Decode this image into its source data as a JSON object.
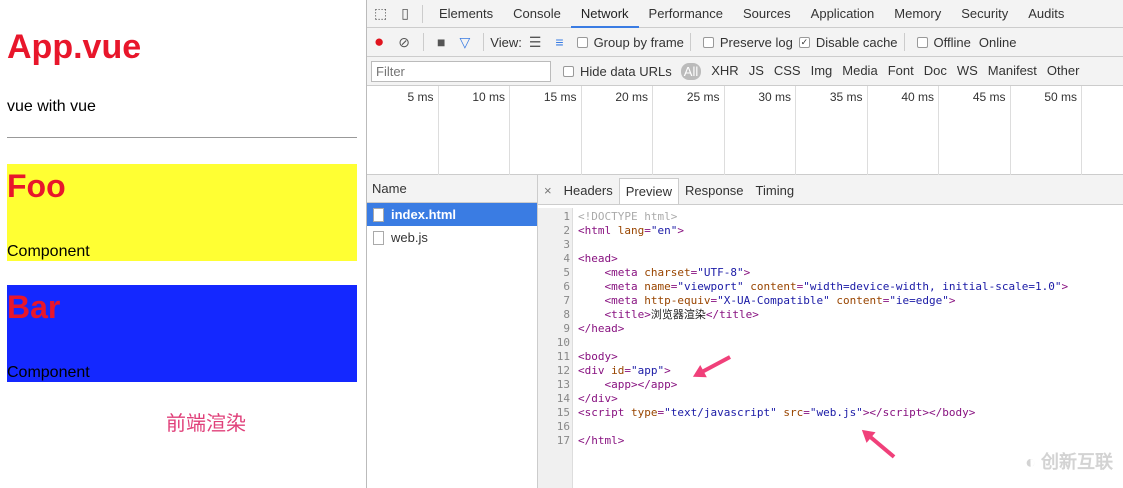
{
  "page": {
    "title": "App.vue",
    "subtitle": "vue with vue",
    "foo": {
      "title": "Foo",
      "label": "Component",
      "bg": "#ffff33"
    },
    "bar": {
      "title": "Bar",
      "label": "Component",
      "bg": "#1428ff"
    },
    "render_label": "前端渲染"
  },
  "devtools": {
    "tabs": [
      "Elements",
      "Console",
      "Network",
      "Performance",
      "Sources",
      "Application",
      "Memory",
      "Security",
      "Audits"
    ],
    "active_tab": "Network",
    "toolbar": {
      "view_label": "View:",
      "group_by_frame": "Group by frame",
      "preserve_log": "Preserve log",
      "disable_cache": "Disable cache",
      "disable_cache_checked": true,
      "offline": "Offline",
      "throttle": "Online"
    },
    "filter": {
      "placeholder": "Filter",
      "hide_data_urls": "Hide data URLs",
      "types": [
        "All",
        "XHR",
        "JS",
        "CSS",
        "Img",
        "Media",
        "Font",
        "Doc",
        "WS",
        "Manifest",
        "Other"
      ],
      "active_type": "All"
    },
    "timeline_ticks": [
      "5 ms",
      "10 ms",
      "15 ms",
      "20 ms",
      "25 ms",
      "30 ms",
      "35 ms",
      "40 ms",
      "45 ms",
      "50 ms"
    ],
    "name_header": "Name",
    "files": [
      {
        "name": "index.html",
        "selected": true
      },
      {
        "name": "web.js",
        "selected": false
      }
    ],
    "detail_tabs": [
      "Headers",
      "Preview",
      "Response",
      "Timing"
    ],
    "active_detail_tab": "Preview",
    "code_lines": [
      [
        [
          "doc",
          "<!DOCTYPE html>"
        ]
      ],
      [
        [
          "tag",
          "<html "
        ],
        [
          "attr",
          "lang"
        ],
        [
          "tag",
          "="
        ],
        [
          "val",
          "\"en\""
        ],
        [
          "tag",
          ">"
        ]
      ],
      [],
      [
        [
          "tag",
          "<head>"
        ]
      ],
      [
        [
          "txt",
          "    "
        ],
        [
          "tag",
          "<meta "
        ],
        [
          "attr",
          "charset"
        ],
        [
          "tag",
          "="
        ],
        [
          "val",
          "\"UTF-8\""
        ],
        [
          "tag",
          ">"
        ]
      ],
      [
        [
          "txt",
          "    "
        ],
        [
          "tag",
          "<meta "
        ],
        [
          "attr",
          "name"
        ],
        [
          "tag",
          "="
        ],
        [
          "val",
          "\"viewport\" "
        ],
        [
          "attr",
          "content"
        ],
        [
          "tag",
          "="
        ],
        [
          "val",
          "\"width=device-width, initial-scale=1.0\""
        ],
        [
          "tag",
          ">"
        ]
      ],
      [
        [
          "txt",
          "    "
        ],
        [
          "tag",
          "<meta "
        ],
        [
          "attr",
          "http-equiv"
        ],
        [
          "tag",
          "="
        ],
        [
          "val",
          "\"X-UA-Compatible\" "
        ],
        [
          "attr",
          "content"
        ],
        [
          "tag",
          "="
        ],
        [
          "val",
          "\"ie=edge\""
        ],
        [
          "tag",
          ">"
        ]
      ],
      [
        [
          "txt",
          "    "
        ],
        [
          "tag",
          "<title>"
        ],
        [
          "txt",
          "浏览器渲染"
        ],
        [
          "tag",
          "</title>"
        ]
      ],
      [
        [
          "tag",
          "</head>"
        ]
      ],
      [],
      [
        [
          "tag",
          "<body>"
        ]
      ],
      [
        [
          "tag",
          "<div "
        ],
        [
          "attr",
          "id"
        ],
        [
          "tag",
          "="
        ],
        [
          "val",
          "\"app\""
        ],
        [
          "tag",
          ">"
        ]
      ],
      [
        [
          "txt",
          "    "
        ],
        [
          "tag",
          "<app></app>"
        ]
      ],
      [
        [
          "tag",
          "</div>"
        ]
      ],
      [
        [
          "tag",
          "<script "
        ],
        [
          "attr",
          "type"
        ],
        [
          "tag",
          "="
        ],
        [
          "val",
          "\"text/javascript\" "
        ],
        [
          "attr",
          "src"
        ],
        [
          "tag",
          "="
        ],
        [
          "val",
          "\"web.js\""
        ],
        [
          "tag",
          "></script></body>"
        ]
      ],
      [],
      [
        [
          "tag",
          "</html>"
        ]
      ]
    ]
  },
  "watermark": "创新互联"
}
